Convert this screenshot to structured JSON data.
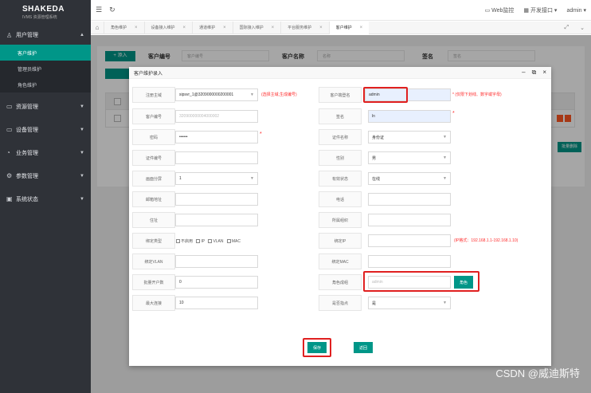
{
  "sidebar": {
    "logo_main": "SHAKEDA",
    "logo_sub": "IVMS 资源管理系统",
    "user_group": "用户管理",
    "user_items": [
      "客户维护",
      "管理员维护",
      "角色维护"
    ],
    "groups": [
      "资源管理",
      "设备管理",
      "业务管理",
      "参数管理",
      "系统状态"
    ]
  },
  "topbar": {
    "web_monitor": "Web监控",
    "dev_interface": "开发接口",
    "user": "admin"
  },
  "tabs": [
    "角色维护",
    "设备接入维护",
    "通道维护",
    "国际接入维护",
    "平台服务维护",
    "客户维护"
  ],
  "background": {
    "add_button": "+ 添入",
    "label_customer_no": "客户编号",
    "ph_customer_no": "客户编号",
    "label_customer_name": "客户名称",
    "ph_customer_name": "名称",
    "label_sign": "签名",
    "ph_sign": "签名",
    "right_button": "批量删除"
  },
  "modal": {
    "title": "客户维护录入",
    "fields": {
      "domain_label": "注册主域",
      "domain_value": "sipsvr_1@3209000000200001",
      "domain_hint": "(选择主域,生成编号)",
      "login_label": "客户端登名",
      "login_value": "admin",
      "login_hint": "* (仅限下划线、数字或字母)",
      "cust_no_label": "客户编号",
      "cust_no_value": "320900000004000002",
      "sign_label": "签名",
      "sign_value": "ln",
      "password_label": "密码",
      "password_value": "••••••",
      "cert_name_label": "证件名称",
      "cert_name_value": "身份证",
      "cert_no_label": "证件编号",
      "gender_label": "性别",
      "gender_value": "男",
      "split_label": "画面分屏",
      "split_value": "1",
      "valid_label": "有效状态",
      "valid_value": "在线",
      "email_label": "邮箱地址",
      "phone_label": "电话",
      "address_label": "住址",
      "org_label": "所属组织",
      "bind_type_label": "绑定类型",
      "bind_options": [
        "不启用",
        "IP",
        "VLAN",
        "MAC"
      ],
      "bind_ip_label": "绑定IP",
      "bind_ip_hint": "(IP格式：192.168.1.1-192.168.1.10)",
      "bind_vlan_label": "绑定VLAN",
      "bind_mac_label": "绑定MAC",
      "batch_label": "批量开户数",
      "batch_value": "0",
      "role_label": "角色成组",
      "role_placeholder": "admin",
      "role_button": "角色",
      "max_conn_label": "最大连接",
      "max_conn_value": "10",
      "login_point_label": "是否指点",
      "login_point_value": "是"
    },
    "save_button": "保存",
    "back_button": "返回"
  },
  "watermark": "CSDN @威迪斯特"
}
